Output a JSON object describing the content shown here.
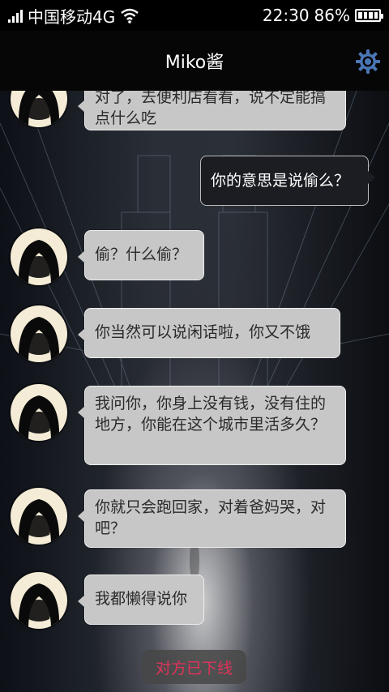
{
  "status_bar": {
    "carrier": "中国移动4G",
    "time": "22:30",
    "battery_pct": "86%"
  },
  "header": {
    "title": "Miko酱",
    "settings_icon": "gear-icon"
  },
  "messages": [
    {
      "side": "left",
      "text": "对了，去便利店看看，说不定能搞点什么吃"
    },
    {
      "side": "right",
      "text": "你的意思是说偷么？"
    },
    {
      "side": "left",
      "text": "偷？什么偷？"
    },
    {
      "side": "left",
      "text": "你当然可以说闲话啦，你又不饿"
    },
    {
      "side": "left",
      "text": "我问你，你身上没有钱，没有住的地方，你能在这个城市里活多久？"
    },
    {
      "side": "left",
      "text": "你就只会跑回家，对着爸妈哭，对吧？"
    },
    {
      "side": "left",
      "text": "我都懒得说你"
    }
  ],
  "footer": {
    "offline_label": "对方已下线"
  },
  "colors": {
    "accent_gear": "#4a76b5",
    "offline_text": "#e0335a"
  }
}
